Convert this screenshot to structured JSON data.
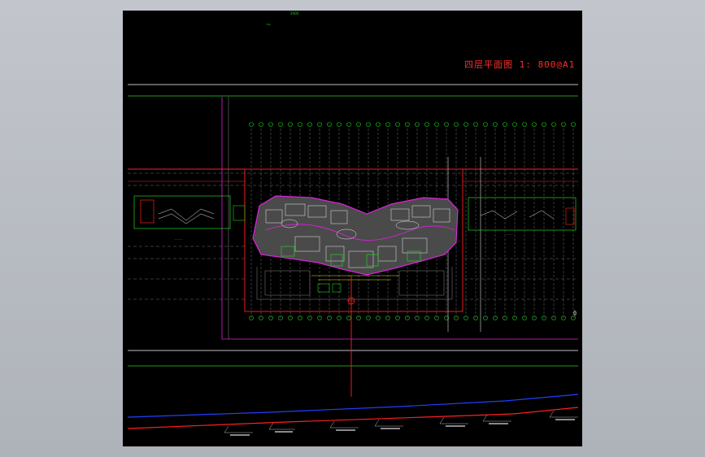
{
  "viewer": {
    "background": "#b6bac1",
    "canvas_background": "#000000"
  },
  "drawing": {
    "title": "四层平面图 1: 800@A1",
    "top_marks": [
      "2000",
      "Y00"
    ],
    "colors": {
      "white": "#ffffff",
      "green": "#20d020",
      "red": "#ff2020",
      "magenta": "#e020e0",
      "yellow": "#e8e020",
      "blue": "#2040ff",
      "gray": "#8a8a8a",
      "cyan": "#20d0d0"
    },
    "icons": [
      "north-arrow-icon",
      "section-marker-icon"
    ]
  }
}
